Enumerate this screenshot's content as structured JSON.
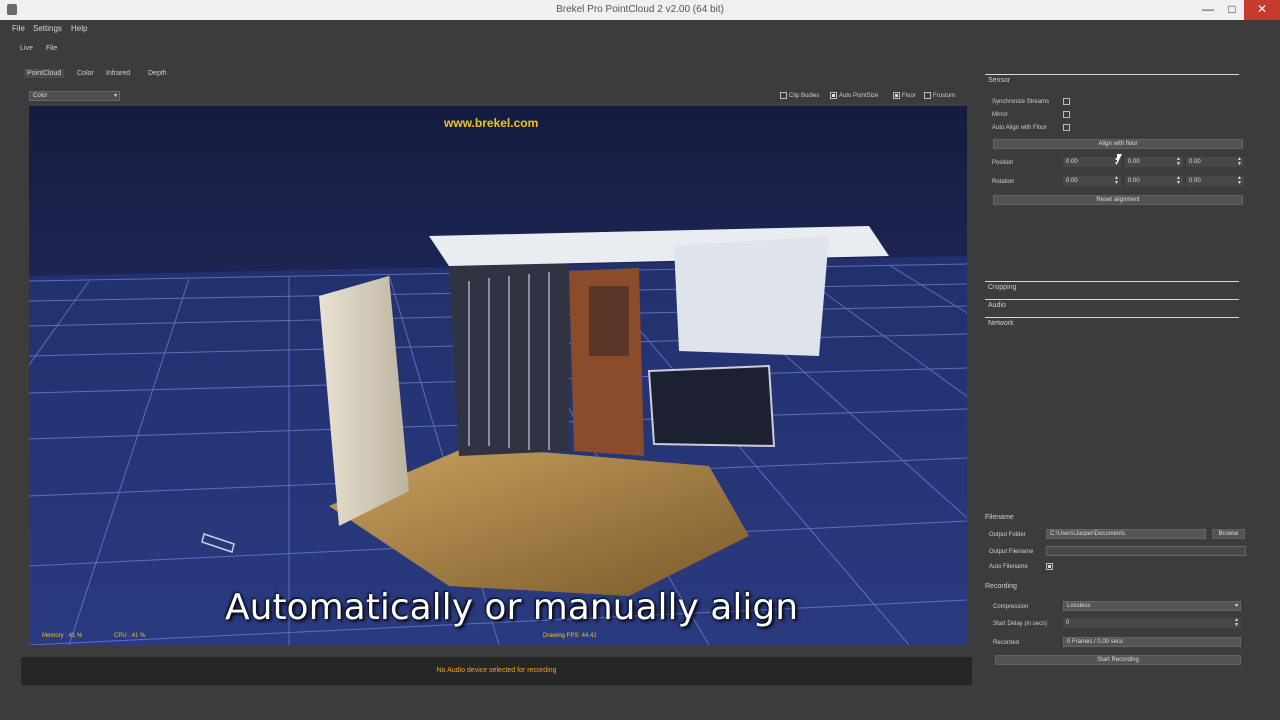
{
  "window": {
    "title": "Brekel Pro PointCloud 2 v2.00 (64 bit)",
    "minimize": "—",
    "maximize": "□",
    "close": "✕"
  },
  "menu": [
    "File",
    "Settings",
    "Help"
  ],
  "toolbar": [
    "Live",
    "File"
  ],
  "tabs": [
    "PointCloud",
    "Color",
    "Infrared",
    "Depth"
  ],
  "viewport": {
    "display_mode": "Color",
    "options": [
      {
        "label": "Clip Bodies",
        "checked": false
      },
      {
        "label": "Auto PointSize",
        "checked": true
      },
      {
        "label": "Floor",
        "checked": true
      },
      {
        "label": "Frustum",
        "checked": false
      }
    ],
    "watermark": "www.brekel.com",
    "subtitle": "Automatically or manually align",
    "memory": "Memory : 41 %",
    "cpu": "CPU : 41 %",
    "fps": "Drawing FPS: 44.41"
  },
  "status_message": "No Audio device selected for recording",
  "sensor": {
    "header": "Sensor",
    "synchronize_streams": {
      "label": "Synchronize Streams",
      "checked": false
    },
    "mirror": {
      "label": "Mirror",
      "checked": false
    },
    "auto_align": {
      "label": "Auto Align with Floor",
      "checked": false
    },
    "align_button": "Align with floor",
    "position_label": "Position",
    "position": [
      "0.00",
      "0.00",
      "0.00"
    ],
    "rotation_label": "Rotation",
    "rotation": [
      "0.00",
      "0.00",
      "0.00"
    ],
    "reset_button": "Reset alignment"
  },
  "collapsed_sections": [
    "Cropping",
    "Audio",
    "Network"
  ],
  "filename": {
    "header": "Filename",
    "output_folder_label": "Output Folder",
    "output_folder_value": "C:\\Users\\Jasper\\Documents",
    "browse_button": "Browse",
    "output_filename_label": "Output Filename",
    "auto_filename": {
      "label": "Auto Filename",
      "checked": true
    }
  },
  "recording": {
    "header": "Recording",
    "compression_label": "Compression",
    "compression_value": "Lossless",
    "start_delay_label": "Start Delay (in secs)",
    "start_delay_value": "0",
    "recorded_label": "Recorded",
    "recorded_value": "0 Frames / 0.00 secs",
    "start_button": "Start Recording"
  }
}
